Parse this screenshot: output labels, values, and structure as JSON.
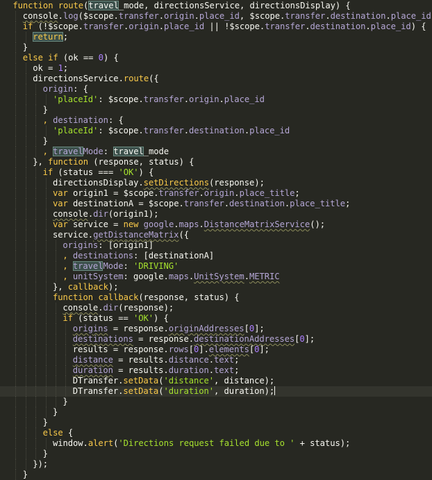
{
  "editor": {
    "language": "javascript",
    "theme": {
      "background": "#272822",
      "current_line": "#33342d",
      "plain": "#f8f8f2",
      "keyword": "#f9c94a",
      "function_name": "#f9c94a",
      "method": "#f9c94a",
      "property": "#b5a7d6",
      "string": "#a6e22e",
      "number": "#ae81ff",
      "highlight_bg": "#3b4f4a"
    },
    "lines": [
      {
        "indent": 1,
        "tokens": [
          {
            "t": "function ",
            "k": "kw"
          },
          {
            "t": "route",
            "k": "fn"
          },
          {
            "t": "(",
            "k": "p"
          },
          {
            "t": "travel",
            "k": "p",
            "hl": true
          },
          {
            "t": "_mode, directionsService, directionsDisplay) {",
            "k": "p"
          }
        ]
      },
      {
        "indent": 2,
        "tokens": [
          {
            "t": "console",
            "k": "p",
            "sq": true
          },
          {
            "t": ".",
            "k": "p"
          },
          {
            "t": "log",
            "k": "prop"
          },
          {
            "t": "($scope.",
            "k": "p"
          },
          {
            "t": "transfer",
            "k": "prop"
          },
          {
            "t": ".",
            "k": "p"
          },
          {
            "t": "origin",
            "k": "prop"
          },
          {
            "t": ".",
            "k": "p"
          },
          {
            "t": "place_id",
            "k": "prop"
          },
          {
            "t": ", $scope.",
            "k": "p"
          },
          {
            "t": "transfer",
            "k": "prop"
          },
          {
            "t": ".",
            "k": "p"
          },
          {
            "t": "destination",
            "k": "prop"
          },
          {
            "t": ".",
            "k": "p"
          },
          {
            "t": "place_id",
            "k": "prop"
          },
          {
            "t": ");",
            "k": "p"
          }
        ]
      },
      {
        "indent": 2,
        "tokens": [
          {
            "t": "if",
            "k": "kw"
          },
          {
            "t": " (!$scope.",
            "k": "p"
          },
          {
            "t": "transfer",
            "k": "prop"
          },
          {
            "t": ".",
            "k": "p"
          },
          {
            "t": "origin",
            "k": "prop"
          },
          {
            "t": ".",
            "k": "p"
          },
          {
            "t": "place_id",
            "k": "prop"
          },
          {
            "t": " || !$scope.",
            "k": "p"
          },
          {
            "t": "transfer",
            "k": "prop"
          },
          {
            "t": ".",
            "k": "p"
          },
          {
            "t": "destination",
            "k": "prop"
          },
          {
            "t": ".",
            "k": "p"
          },
          {
            "t": "place_id",
            "k": "prop"
          },
          {
            "t": ") {",
            "k": "p"
          }
        ]
      },
      {
        "indent": 3,
        "tokens": [
          {
            "t": "return",
            "k": "kw",
            "hl": true
          },
          {
            "t": ";",
            "k": "p"
          }
        ]
      },
      {
        "indent": 2,
        "tokens": [
          {
            "t": "}",
            "k": "p"
          }
        ]
      },
      {
        "indent": 2,
        "tokens": [
          {
            "t": "else if",
            "k": "kw"
          },
          {
            "t": " (ok == ",
            "k": "p"
          },
          {
            "t": "0",
            "k": "num"
          },
          {
            "t": ") {",
            "k": "p"
          }
        ]
      },
      {
        "indent": 3,
        "tokens": [
          {
            "t": "ok = ",
            "k": "p"
          },
          {
            "t": "1",
            "k": "num"
          },
          {
            "t": ";",
            "k": "p"
          }
        ]
      },
      {
        "indent": 3,
        "tokens": [
          {
            "t": "directionsService.",
            "k": "p"
          },
          {
            "t": "route",
            "k": "meth"
          },
          {
            "t": "({",
            "k": "p"
          }
        ]
      },
      {
        "indent": 4,
        "tokens": [
          {
            "t": "origin",
            "k": "prop"
          },
          {
            "t": ": {",
            "k": "p"
          }
        ]
      },
      {
        "indent": 5,
        "tokens": [
          {
            "t": "'placeId'",
            "k": "str"
          },
          {
            "t": ": $scope.",
            "k": "p"
          },
          {
            "t": "transfer",
            "k": "prop"
          },
          {
            "t": ".",
            "k": "p"
          },
          {
            "t": "origin",
            "k": "prop"
          },
          {
            "t": ".",
            "k": "p"
          },
          {
            "t": "place_id",
            "k": "prop"
          }
        ]
      },
      {
        "indent": 4,
        "tokens": [
          {
            "t": "}",
            "k": "p"
          }
        ]
      },
      {
        "indent": 4,
        "tokens": [
          {
            "t": ", ",
            "k": "kw"
          },
          {
            "t": "destination",
            "k": "prop"
          },
          {
            "t": ": {",
            "k": "p"
          }
        ]
      },
      {
        "indent": 5,
        "tokens": [
          {
            "t": "'placeId'",
            "k": "str"
          },
          {
            "t": ": $scope.",
            "k": "p"
          },
          {
            "t": "transfer",
            "k": "prop"
          },
          {
            "t": ".",
            "k": "p"
          },
          {
            "t": "destination",
            "k": "prop"
          },
          {
            "t": ".",
            "k": "p"
          },
          {
            "t": "place_id",
            "k": "prop"
          }
        ]
      },
      {
        "indent": 4,
        "tokens": [
          {
            "t": "}",
            "k": "p"
          }
        ]
      },
      {
        "indent": 4,
        "tokens": [
          {
            "t": ", ",
            "k": "kw"
          },
          {
            "t": "travel",
            "k": "prop",
            "hl": true
          },
          {
            "t": "Mode",
            "k": "prop"
          },
          {
            "t": ": ",
            "k": "p"
          },
          {
            "t": "travel",
            "k": "p",
            "hl": true
          },
          {
            "t": "_mode",
            "k": "p"
          }
        ]
      },
      {
        "indent": 3,
        "tokens": [
          {
            "t": "}, ",
            "k": "p"
          },
          {
            "t": "function",
            "k": "kw"
          },
          {
            "t": " (response, status) {",
            "k": "p"
          }
        ]
      },
      {
        "indent": 4,
        "tokens": [
          {
            "t": "if",
            "k": "kw"
          },
          {
            "t": " (status === ",
            "k": "p"
          },
          {
            "t": "'OK'",
            "k": "str"
          },
          {
            "t": ") {",
            "k": "p"
          }
        ]
      },
      {
        "indent": 5,
        "tokens": [
          {
            "t": "directionsDisplay.",
            "k": "p"
          },
          {
            "t": "setDirections",
            "k": "meth",
            "sq": true
          },
          {
            "t": "(response);",
            "k": "p"
          }
        ]
      },
      {
        "indent": 5,
        "tokens": [
          {
            "t": "var",
            "k": "kw"
          },
          {
            "t": " origin1 = $scope.",
            "k": "p"
          },
          {
            "t": "transfer",
            "k": "prop"
          },
          {
            "t": ".",
            "k": "p"
          },
          {
            "t": "origin",
            "k": "prop"
          },
          {
            "t": ".",
            "k": "p"
          },
          {
            "t": "place_title",
            "k": "prop"
          },
          {
            "t": ";",
            "k": "p"
          }
        ]
      },
      {
        "indent": 5,
        "tokens": [
          {
            "t": "var",
            "k": "kw"
          },
          {
            "t": " destinationA = $scope.",
            "k": "p"
          },
          {
            "t": "transfer",
            "k": "prop"
          },
          {
            "t": ".",
            "k": "p"
          },
          {
            "t": "destination",
            "k": "prop"
          },
          {
            "t": ".",
            "k": "p"
          },
          {
            "t": "place_title",
            "k": "prop"
          },
          {
            "t": ";",
            "k": "p"
          }
        ]
      },
      {
        "indent": 5,
        "tokens": [
          {
            "t": "console",
            "k": "p",
            "sq": true
          },
          {
            "t": ".",
            "k": "p"
          },
          {
            "t": "dir",
            "k": "prop"
          },
          {
            "t": "(origin1);",
            "k": "p"
          }
        ]
      },
      {
        "indent": 5,
        "tokens": [
          {
            "t": "var",
            "k": "kw"
          },
          {
            "t": " service = ",
            "k": "p"
          },
          {
            "t": "new",
            "k": "kw"
          },
          {
            "t": " ",
            "k": "p"
          },
          {
            "t": "google",
            "k": "prop"
          },
          {
            "t": ".",
            "k": "p"
          },
          {
            "t": "maps",
            "k": "prop"
          },
          {
            "t": ".",
            "k": "p"
          },
          {
            "t": "DistanceMatrixService",
            "k": "prop",
            "sq": true
          },
          {
            "t": "();",
            "k": "p"
          }
        ]
      },
      {
        "indent": 5,
        "tokens": [
          {
            "t": "service.",
            "k": "p"
          },
          {
            "t": "getDistanceMatrix",
            "k": "prop",
            "sq": true
          },
          {
            "t": "({",
            "k": "p"
          }
        ]
      },
      {
        "indent": 6,
        "tokens": [
          {
            "t": "origins",
            "k": "prop"
          },
          {
            "t": ": [origin1]",
            "k": "p"
          }
        ]
      },
      {
        "indent": 6,
        "tokens": [
          {
            "t": ", ",
            "k": "kw"
          },
          {
            "t": "destinations",
            "k": "prop"
          },
          {
            "t": ": [destinationA]",
            "k": "p"
          }
        ]
      },
      {
        "indent": 6,
        "tokens": [
          {
            "t": ", ",
            "k": "kw"
          },
          {
            "t": "travel",
            "k": "prop",
            "hl": true
          },
          {
            "t": "Mode",
            "k": "prop"
          },
          {
            "t": ": ",
            "k": "p"
          },
          {
            "t": "'DRIVING'",
            "k": "str"
          }
        ]
      },
      {
        "indent": 6,
        "tokens": [
          {
            "t": ", ",
            "k": "kw"
          },
          {
            "t": "unitSystem",
            "k": "prop"
          },
          {
            "t": ": google.",
            "k": "p"
          },
          {
            "t": "maps",
            "k": "prop"
          },
          {
            "t": ".",
            "k": "p"
          },
          {
            "t": "UnitSystem",
            "k": "prop",
            "sq": true
          },
          {
            "t": ".",
            "k": "p"
          },
          {
            "t": "METRIC",
            "k": "prop",
            "sq": true
          }
        ]
      },
      {
        "indent": 5,
        "tokens": [
          {
            "t": "}, ",
            "k": "p"
          },
          {
            "t": "callback",
            "k": "fn"
          },
          {
            "t": ");",
            "k": "p"
          }
        ]
      },
      {
        "indent": 5,
        "tokens": [
          {
            "t": "function",
            "k": "kw"
          },
          {
            "t": " ",
            "k": "p"
          },
          {
            "t": "callback",
            "k": "fn"
          },
          {
            "t": "(response, status) {",
            "k": "p"
          }
        ]
      },
      {
        "indent": 6,
        "tokens": [
          {
            "t": "console",
            "k": "p",
            "sq": true
          },
          {
            "t": ".",
            "k": "p"
          },
          {
            "t": "dir",
            "k": "prop"
          },
          {
            "t": "(response);",
            "k": "p"
          }
        ]
      },
      {
        "indent": 6,
        "tokens": [
          {
            "t": "if",
            "k": "kw"
          },
          {
            "t": " (status == ",
            "k": "p"
          },
          {
            "t": "'OK'",
            "k": "str"
          },
          {
            "t": ") {",
            "k": "p"
          }
        ]
      },
      {
        "indent": 7,
        "tokens": [
          {
            "t": "origins",
            "k": "prop",
            "sq": true
          },
          {
            "t": " = response.",
            "k": "p"
          },
          {
            "t": "originAddresses",
            "k": "prop",
            "sq": true
          },
          {
            "t": "[",
            "k": "p"
          },
          {
            "t": "0",
            "k": "num"
          },
          {
            "t": "];",
            "k": "p"
          }
        ]
      },
      {
        "indent": 7,
        "tokens": [
          {
            "t": "destinations",
            "k": "prop",
            "sq": true
          },
          {
            "t": " = response.",
            "k": "p"
          },
          {
            "t": "destinationAddresses",
            "k": "prop",
            "sq": true
          },
          {
            "t": "[",
            "k": "p"
          },
          {
            "t": "0",
            "k": "num"
          },
          {
            "t": "];",
            "k": "p"
          }
        ]
      },
      {
        "indent": 7,
        "tokens": [
          {
            "t": "results = response.",
            "k": "p"
          },
          {
            "t": "rows",
            "k": "prop"
          },
          {
            "t": "[",
            "k": "p"
          },
          {
            "t": "0",
            "k": "num"
          },
          {
            "t": "].",
            "k": "p"
          },
          {
            "t": "elements",
            "k": "prop",
            "sq": true
          },
          {
            "t": "[",
            "k": "p"
          },
          {
            "t": "0",
            "k": "num"
          },
          {
            "t": "];",
            "k": "p"
          }
        ]
      },
      {
        "indent": 7,
        "tokens": [
          {
            "t": "distance",
            "k": "prop",
            "sq": true
          },
          {
            "t": " = results.",
            "k": "p"
          },
          {
            "t": "distance",
            "k": "prop"
          },
          {
            "t": ".",
            "k": "p"
          },
          {
            "t": "text",
            "k": "prop"
          },
          {
            "t": ";",
            "k": "p"
          }
        ]
      },
      {
        "indent": 7,
        "tokens": [
          {
            "t": "duration",
            "k": "prop",
            "sq": true
          },
          {
            "t": " = results.",
            "k": "p"
          },
          {
            "t": "duration",
            "k": "prop"
          },
          {
            "t": ".",
            "k": "p"
          },
          {
            "t": "text",
            "k": "prop"
          },
          {
            "t": ";",
            "k": "p"
          }
        ]
      },
      {
        "indent": 7,
        "tokens": [
          {
            "t": "DTransfer.",
            "k": "p"
          },
          {
            "t": "setData",
            "k": "meth"
          },
          {
            "t": "(",
            "k": "p"
          },
          {
            "t": "'distance'",
            "k": "str"
          },
          {
            "t": ", distance);",
            "k": "p"
          }
        ]
      },
      {
        "indent": 7,
        "current": true,
        "caret": true,
        "tokens": [
          {
            "t": "DTransfer.",
            "k": "p"
          },
          {
            "t": "setData",
            "k": "meth"
          },
          {
            "t": "(",
            "k": "p"
          },
          {
            "t": "'duration'",
            "k": "str"
          },
          {
            "t": ", duration);",
            "k": "p"
          }
        ]
      },
      {
        "indent": 6,
        "tokens": [
          {
            "t": "}",
            "k": "p"
          }
        ]
      },
      {
        "indent": 5,
        "tokens": [
          {
            "t": "}",
            "k": "p"
          }
        ]
      },
      {
        "indent": 4,
        "tokens": [
          {
            "t": "}",
            "k": "p"
          }
        ]
      },
      {
        "indent": 4,
        "tokens": [
          {
            "t": "else",
            "k": "kw"
          },
          {
            "t": " {",
            "k": "p"
          }
        ]
      },
      {
        "indent": 5,
        "tokens": [
          {
            "t": "window.",
            "k": "p"
          },
          {
            "t": "alert",
            "k": "meth"
          },
          {
            "t": "(",
            "k": "p"
          },
          {
            "t": "'Directions request failed due to '",
            "k": "str"
          },
          {
            "t": " + status);",
            "k": "p"
          }
        ]
      },
      {
        "indent": 4,
        "tokens": [
          {
            "t": "}",
            "k": "p"
          }
        ]
      },
      {
        "indent": 3,
        "tokens": [
          {
            "t": "});",
            "k": "p"
          }
        ]
      },
      {
        "indent": 2,
        "tokens": [
          {
            "t": "}",
            "k": "p"
          }
        ]
      }
    ]
  }
}
